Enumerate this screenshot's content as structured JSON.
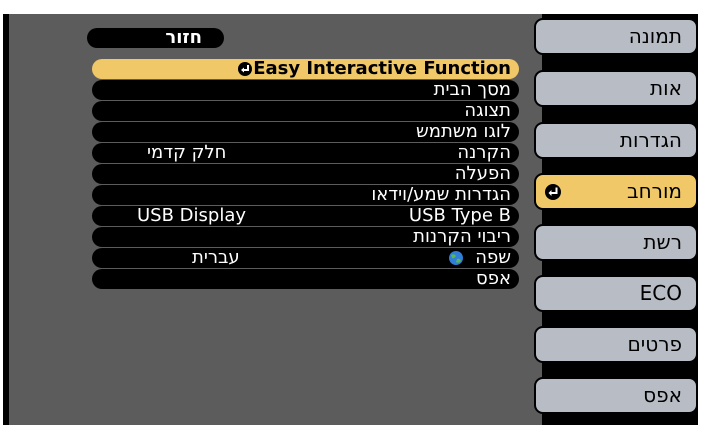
{
  "back_label": "חזור",
  "menu_rows": [
    {
      "label": "Easy Interactive Function",
      "value": ""
    },
    {
      "label": "מסך הבית",
      "value": ""
    },
    {
      "label": "תצוגה",
      "value": ""
    },
    {
      "label": "לוגו משתמש",
      "value": ""
    },
    {
      "label": "הקרנה",
      "value": "חלק קדמי"
    },
    {
      "label": "הפעלה",
      "value": ""
    },
    {
      "label": "הגדרות שמע/וידאו",
      "value": ""
    },
    {
      "label": "USB Type B",
      "value": "USB Display"
    },
    {
      "label": "ריבוי הקרנות",
      "value": ""
    },
    {
      "label": "שפה",
      "value": "עברית"
    },
    {
      "label": "אפס",
      "value": ""
    }
  ],
  "sidebar_items": [
    {
      "label": "תמונה"
    },
    {
      "label": "אות"
    },
    {
      "label": "הגדרות"
    },
    {
      "label": "מורחב"
    },
    {
      "label": "רשת"
    },
    {
      "label": "ECO"
    },
    {
      "label": "פרטים"
    },
    {
      "label": "אפס"
    }
  ],
  "colors": {
    "accent": "#f0c868",
    "sidebar": "#b7bcc5",
    "panel": "#5c5c5c",
    "frame": "#000000"
  },
  "icons": {
    "enter": "enter-arrow-icon",
    "language": "globe-icon"
  }
}
